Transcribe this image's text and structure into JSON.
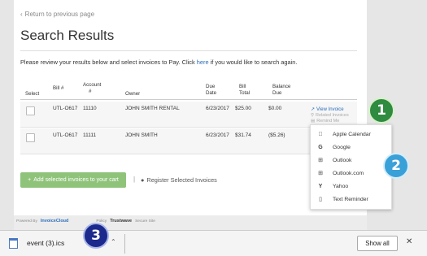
{
  "page": {
    "return_link": "Return to previous page",
    "title": "Search Results",
    "instructions_before": "Please review your results below and select invoices to Pay. Click",
    "instructions_link": "here",
    "instructions_after": "if you would like to search again."
  },
  "table": {
    "headers": {
      "select": "Select",
      "bill_1": "Bill #",
      "account_1": "Account",
      "account_2": "#",
      "owner": "Owner",
      "due_1": "Due",
      "due_2": "Date",
      "bill_total_1": "Bill",
      "bill_total_2": "Total",
      "balance_1": "Balance",
      "balance_2": "Due"
    },
    "rows": [
      {
        "bill": "UTL-O617",
        "account": "11110",
        "owner": "JOHN SMITH RENTAL",
        "due_date": "6/23/2017",
        "bill_total": "$25.00",
        "balance_due": "$0.00"
      },
      {
        "bill": "UTL-O617",
        "account": "11111",
        "owner": "JOHN SMITH",
        "due_date": "6/23/2017",
        "bill_total": "$31.74",
        "balance_due": "($5.26)"
      }
    ],
    "actions": {
      "view_invoice": "View Invoice",
      "related_invoices": "Related Invoices",
      "remind_me": "Remind Me"
    }
  },
  "buttons": {
    "add_selected": "Add selected invoices to your cart",
    "separator": "|",
    "register_selected": "Register Selected Invoices"
  },
  "remind_menu": {
    "items": [
      {
        "label": "Apple Calendar",
        "icon": "apple-icon",
        "glyph": ""
      },
      {
        "label": "Google",
        "icon": "google-icon",
        "glyph": "G"
      },
      {
        "label": "Outlook",
        "icon": "windows-icon",
        "glyph": "⊞"
      },
      {
        "label": "Outlook.com",
        "icon": "windows-icon",
        "glyph": "⊞"
      },
      {
        "label": "Yahoo",
        "icon": "yahoo-icon",
        "glyph": "Y"
      },
      {
        "label": "Text Reminder",
        "icon": "phone-icon",
        "glyph": "▯"
      }
    ]
  },
  "footer": {
    "powered_by": "Powered By",
    "brand": "InvoiceCloud",
    "policy": "Policy",
    "trustwave": "Trustwave",
    "secure_site": "Secure Site"
  },
  "badges": {
    "one": "1",
    "two": "2",
    "three": "3"
  },
  "download_bar": {
    "file_name": "event (3).ics",
    "show_all": "Show all"
  },
  "colors": {
    "link": "#2a6ebb",
    "add_button": "#8fc37a",
    "badge_1": "#2e8b3f",
    "badge_2": "#3aa0d8",
    "badge_3": "#1b2a8c"
  }
}
